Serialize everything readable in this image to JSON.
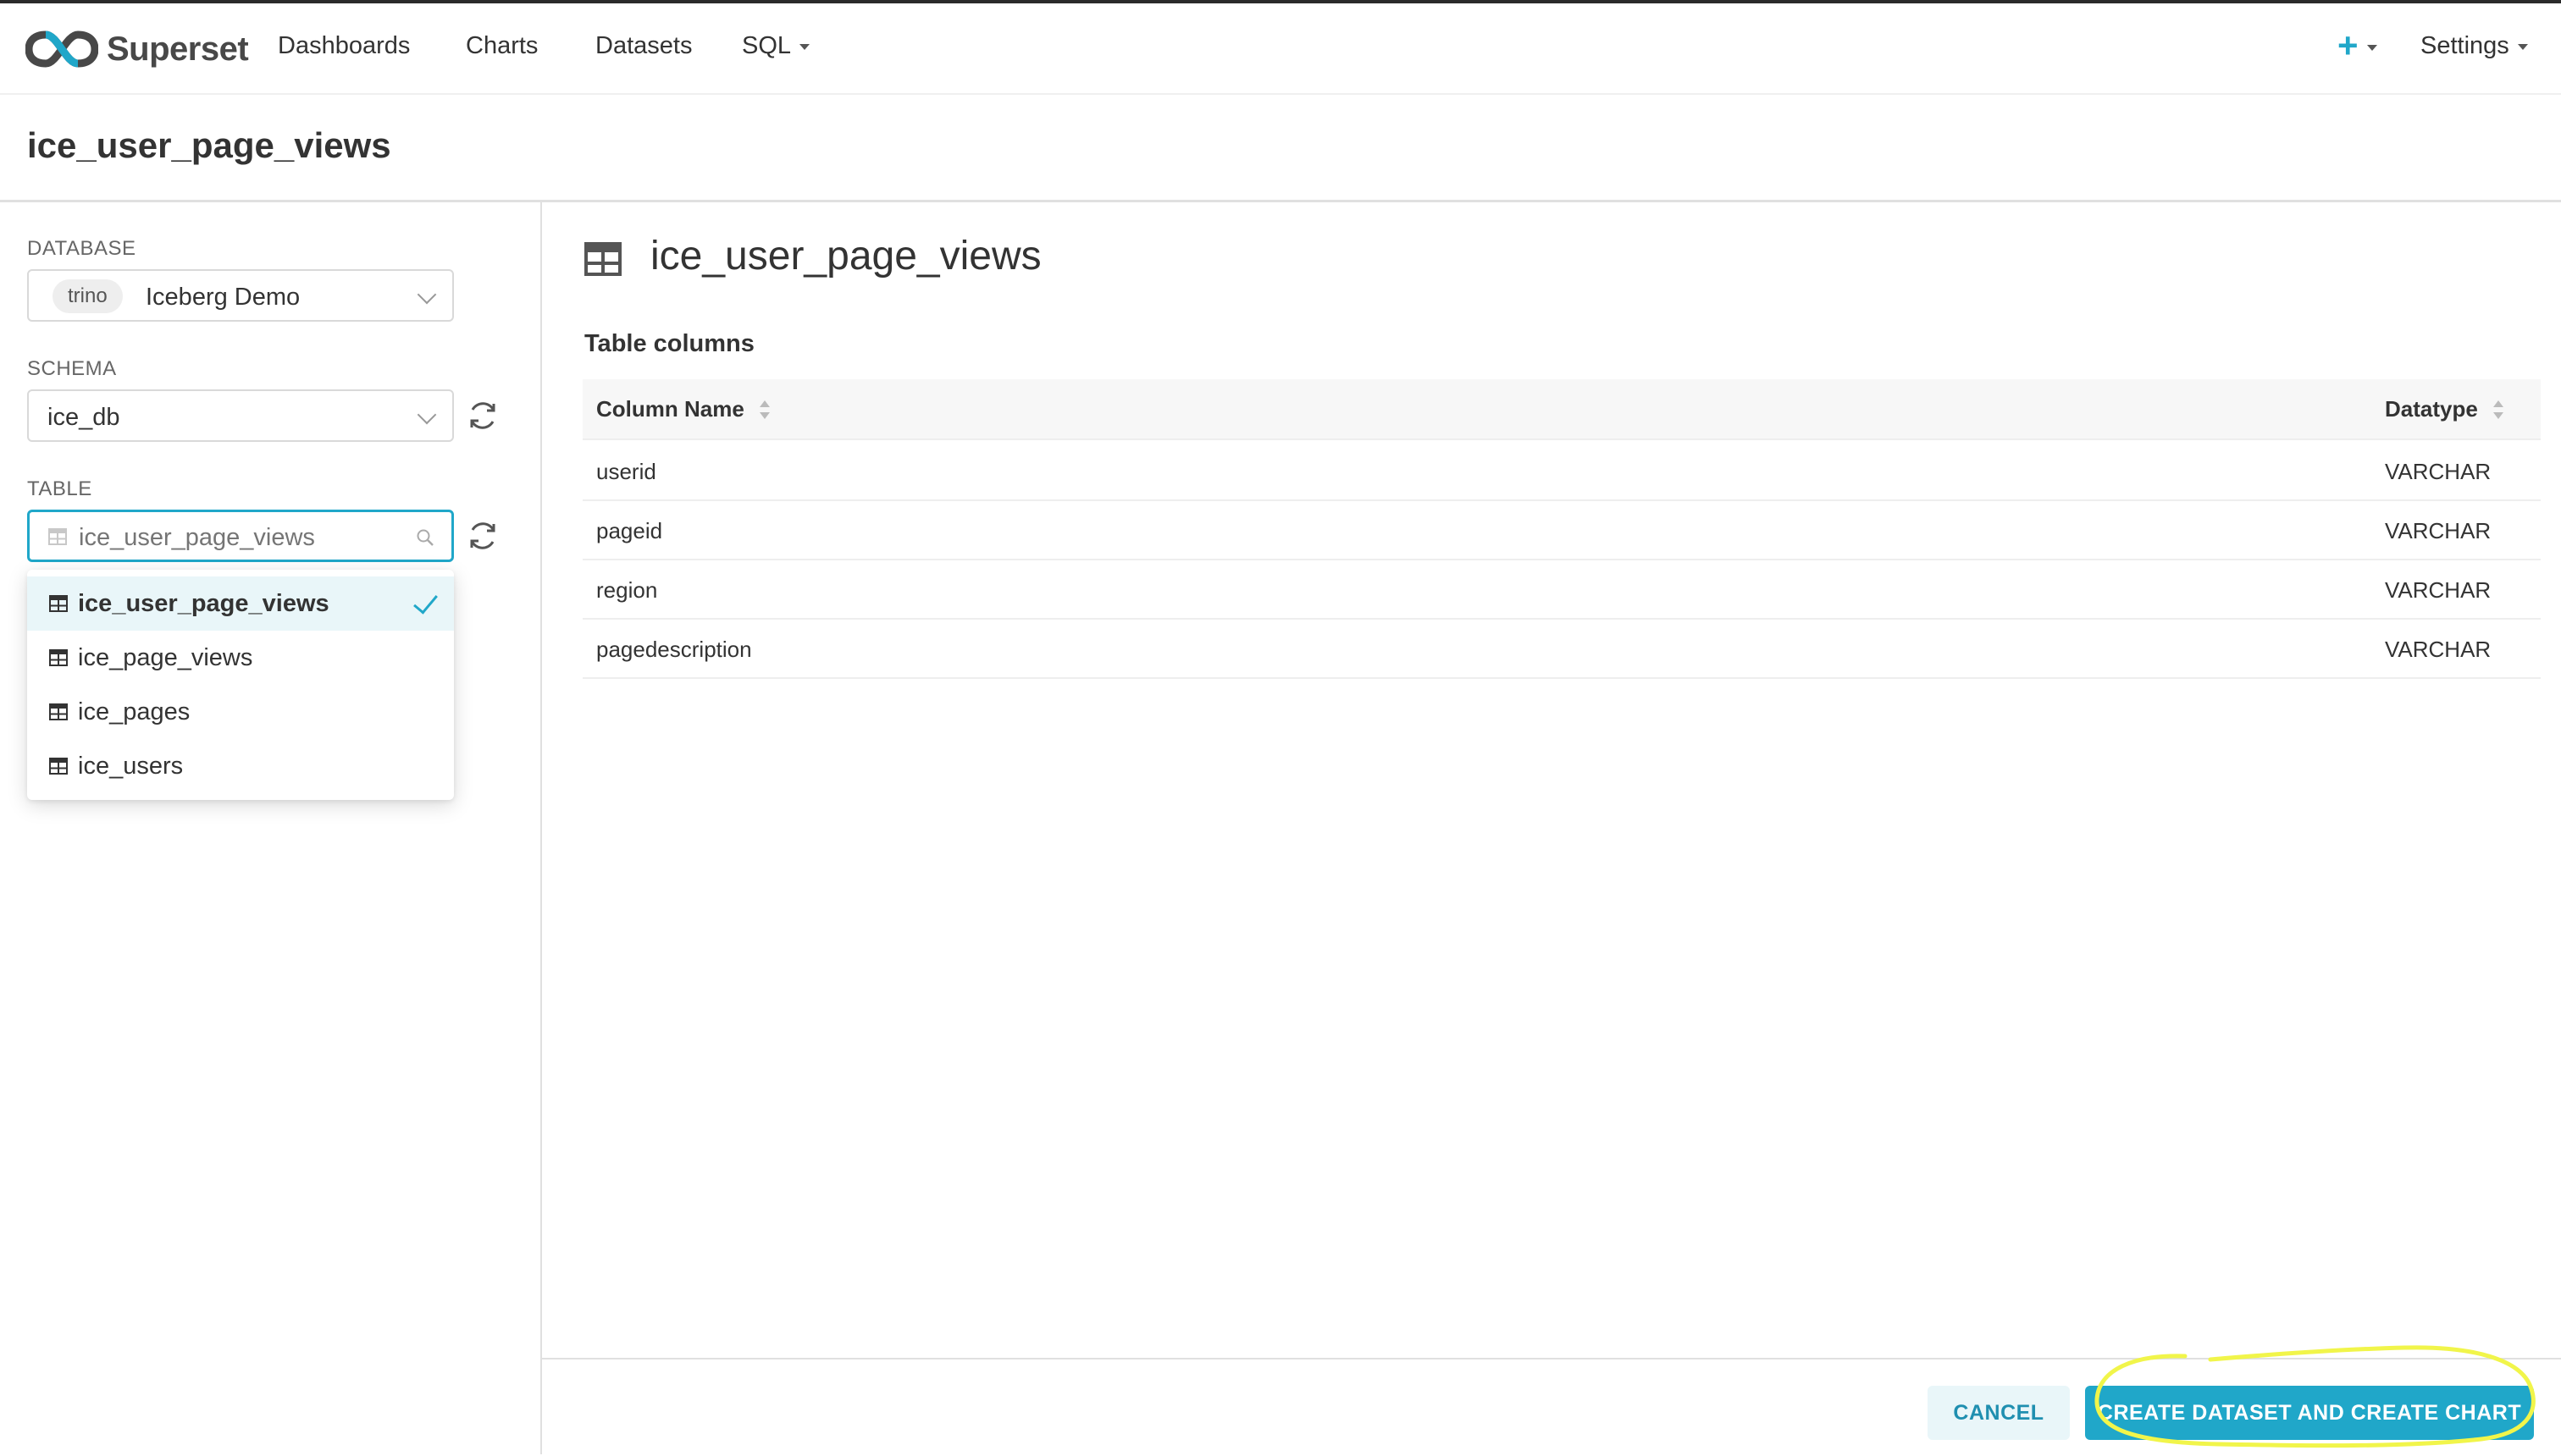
{
  "navbar": {
    "brand": "Superset",
    "items": [
      {
        "label": "Dashboards"
      },
      {
        "label": "Charts"
      },
      {
        "label": "Datasets"
      },
      {
        "label": "SQL"
      }
    ],
    "plus_label": "+",
    "settings_label": "Settings"
  },
  "page": {
    "title": "ice_user_page_views"
  },
  "left": {
    "database": {
      "label": "DATABASE",
      "tag": "trino",
      "value": "Iceberg Demo"
    },
    "schema": {
      "label": "SCHEMA",
      "value": "ice_db"
    },
    "table": {
      "label": "TABLE",
      "placeholder": "ice_user_page_views",
      "options": [
        {
          "label": "ice_user_page_views",
          "selected": true
        },
        {
          "label": "ice_page_views",
          "selected": false
        },
        {
          "label": "ice_pages",
          "selected": false
        },
        {
          "label": "ice_users",
          "selected": false
        }
      ]
    }
  },
  "main": {
    "title": "ice_user_page_views",
    "subtitle": "Table columns",
    "columns": [
      "Column Name",
      "Datatype"
    ],
    "rows": [
      {
        "name": "userid",
        "type": "VARCHAR"
      },
      {
        "name": "pageid",
        "type": "VARCHAR"
      },
      {
        "name": "region",
        "type": "VARCHAR"
      },
      {
        "name": "pagedescription",
        "type": "VARCHAR"
      }
    ]
  },
  "footer": {
    "cancel_label": "CANCEL",
    "create_label": "CREATE DATASET AND CREATE CHART"
  },
  "colors": {
    "accent": "#20a7c9",
    "annotation": "#f1f54a"
  }
}
